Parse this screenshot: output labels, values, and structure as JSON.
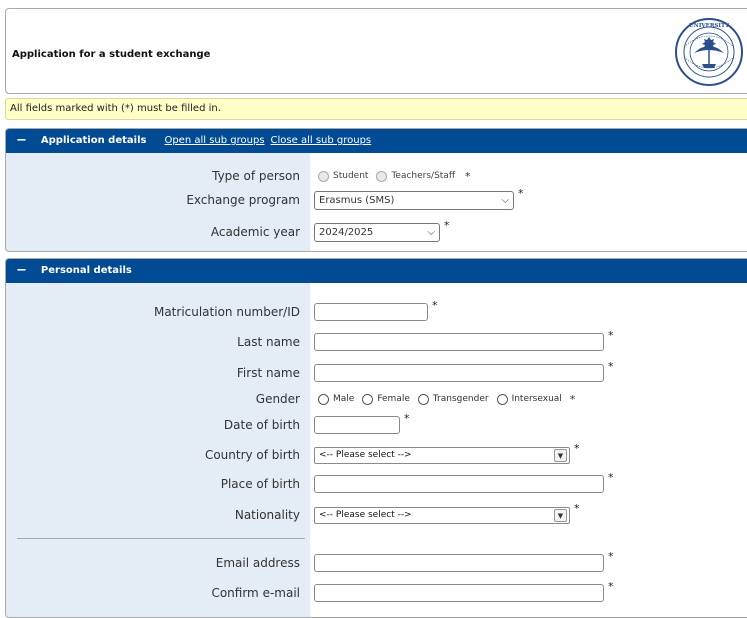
{
  "header": {
    "title": "Application for a student exchange",
    "logo_text": "UNIVERSITY"
  },
  "notice": "All fields marked with (*) must be filled in.",
  "application_group": {
    "toggle": "−",
    "title": "Application details",
    "open_all": "Open all sub groups",
    "close_all": "Close all sub groups",
    "type_of_person": {
      "label": "Type of person",
      "options": [
        "Student",
        "Teachers/Staff"
      ],
      "required": "*"
    },
    "exchange_program": {
      "label": "Exchange program",
      "value": "Erasmus (SMS)",
      "required": "*"
    },
    "academic_year": {
      "label": "Academic year",
      "value": "2024/2025",
      "required": "*"
    }
  },
  "personal_group": {
    "toggle": "−",
    "title": "Personal details",
    "matriculation": {
      "label": "Matriculation number/ID",
      "value": "",
      "required": "*"
    },
    "last_name": {
      "label": "Last name",
      "value": "",
      "required": "*"
    },
    "first_name": {
      "label": "First name",
      "value": "",
      "required": "*"
    },
    "gender": {
      "label": "Gender",
      "options": [
        "Male",
        "Female",
        "Transgender",
        "Intersexual"
      ],
      "required": "*"
    },
    "date_of_birth": {
      "label": "Date of birth",
      "value": "",
      "required": "*"
    },
    "country_of_birth": {
      "label": "Country of birth",
      "value": "<-- Please select -->",
      "required": "*"
    },
    "place_of_birth": {
      "label": "Place of birth",
      "value": "",
      "required": "*"
    },
    "nationality": {
      "label": "Nationality",
      "value": "<-- Please select -->",
      "required": "*"
    },
    "email": {
      "label": "Email address",
      "value": "",
      "required": "*"
    },
    "confirm_email": {
      "label": "Confirm e-mail",
      "value": "",
      "required": "*"
    }
  },
  "colors": {
    "header_blue": "#004b93",
    "label_column": "#e4ecf6",
    "notice_bg": "#ffffc8"
  },
  "icons": {
    "chevron": "chevron-down-icon",
    "dropdown": "dropdown-arrow-icon",
    "logo": "university-seal-icon"
  }
}
